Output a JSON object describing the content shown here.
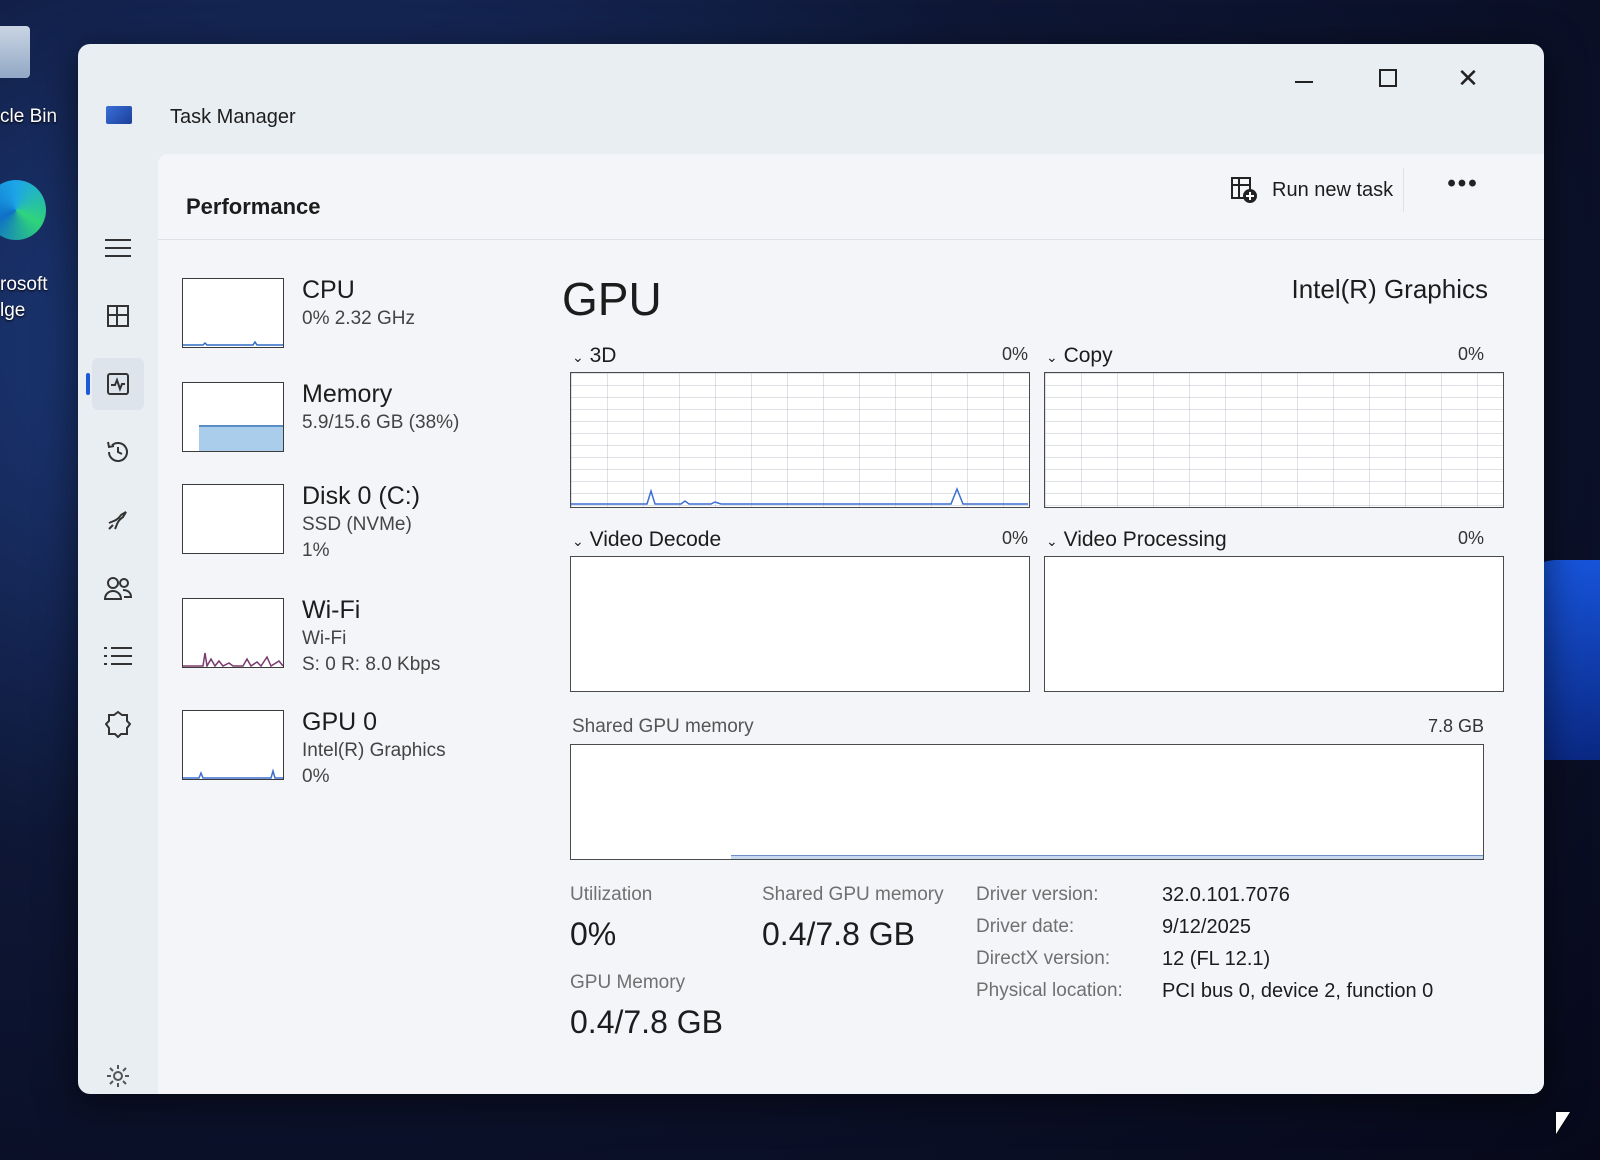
{
  "desktop": {
    "recycle_bin_label": "cle Bin",
    "edge_label_line1": "rosoft",
    "edge_label_line2": "lge"
  },
  "window": {
    "title": "Task Manager",
    "minimize_icon": "minimize-icon",
    "maximize_icon": "maximize-icon",
    "close_glyph": "✕"
  },
  "nav": {
    "items": [
      {
        "icon": "hamburger-menu-icon"
      },
      {
        "icon": "processes-icon"
      },
      {
        "icon": "performance-icon",
        "active": true
      },
      {
        "icon": "app-history-icon"
      },
      {
        "icon": "startup-apps-icon"
      },
      {
        "icon": "users-icon"
      },
      {
        "icon": "details-icon"
      },
      {
        "icon": "services-icon"
      },
      {
        "icon": "settings-icon"
      }
    ]
  },
  "header": {
    "title": "Performance",
    "run_task_label": "Run new task",
    "more_label": "•••"
  },
  "devices": [
    {
      "name": "CPU",
      "line1": "0% 2.32 GHz",
      "line2": ""
    },
    {
      "name": "Memory",
      "line1": "5.9/15.6 GB (38%)",
      "line2": ""
    },
    {
      "name": "Disk 0 (C:)",
      "line1": "SSD (NVMe)",
      "line2": "1%"
    },
    {
      "name": "Wi-Fi",
      "line1": "Wi-Fi",
      "line2": "S: 0 R: 8.0 Kbps"
    },
    {
      "name": "GPU 0",
      "line1": "Intel(R) Graphics",
      "line2": "0%"
    }
  ],
  "gpu": {
    "title": "GPU",
    "model": "Intel(R) Graphics",
    "engines": [
      {
        "label": "3D",
        "pct": "0%"
      },
      {
        "label": "Copy",
        "pct": "0%"
      },
      {
        "label": "Video Decode",
        "pct": "0%"
      },
      {
        "label": "Video Processing",
        "pct": "0%"
      }
    ],
    "shared_mem_label": "Shared GPU memory",
    "shared_mem_max": "7.8 GB",
    "stats": {
      "utilization_label": "Utilization",
      "utilization_value": "0%",
      "shared_label": "Shared GPU memory",
      "shared_value": "0.4/7.8 GB",
      "gpu_mem_label": "GPU Memory",
      "gpu_mem_value": "0.4/7.8 GB"
    },
    "info": [
      {
        "label": "Driver version:",
        "value": "32.0.101.7076"
      },
      {
        "label": "Driver date:",
        "value": "9/12/2025"
      },
      {
        "label": "DirectX version:",
        "value": "12 (FL 12.1)"
      },
      {
        "label": "Physical location:",
        "value": "PCI bus 0, device 2, function 0"
      }
    ]
  },
  "colors": {
    "accent": "#1d5bd6",
    "memory_fill": "#a9cdea",
    "wifi_line": "#7a3a6e",
    "gpu_line": "#3b6fd0"
  }
}
